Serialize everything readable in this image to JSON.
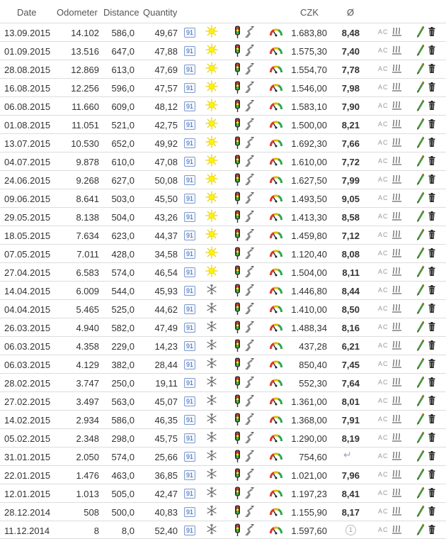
{
  "header": {
    "date": "Date",
    "odometer": "Odometer",
    "distance": "Distance",
    "quantity": "Quantity",
    "price": "CZK",
    "consumption": "Ø"
  },
  "colors": {
    "fuel_badge": "#3466b3",
    "summer_sun": "#f5e600",
    "pencil_body": "#4caa3a",
    "pencil_tip": "#d84a1b",
    "traffic_light": "#333333"
  },
  "rows": [
    {
      "date": "13.09.2015",
      "odometer": "14.102",
      "distance": "586,0",
      "quantity": "49,67",
      "fuel": "91",
      "season": "summer",
      "price": "1.683,80",
      "consumption": "8,48",
      "consumption_icon": ""
    },
    {
      "date": "01.09.2015",
      "odometer": "13.516",
      "distance": "647,0",
      "quantity": "47,88",
      "fuel": "91",
      "season": "summer",
      "price": "1.575,30",
      "consumption": "7,40",
      "consumption_icon": ""
    },
    {
      "date": "28.08.2015",
      "odometer": "12.869",
      "distance": "613,0",
      "quantity": "47,69",
      "fuel": "91",
      "season": "summer",
      "price": "1.554,70",
      "consumption": "7,78",
      "consumption_icon": ""
    },
    {
      "date": "16.08.2015",
      "odometer": "12.256",
      "distance": "596,0",
      "quantity": "47,57",
      "fuel": "91",
      "season": "summer",
      "price": "1.546,00",
      "consumption": "7,98",
      "consumption_icon": ""
    },
    {
      "date": "06.08.2015",
      "odometer": "11.660",
      "distance": "609,0",
      "quantity": "48,12",
      "fuel": "91",
      "season": "summer",
      "price": "1.583,10",
      "consumption": "7,90",
      "consumption_icon": ""
    },
    {
      "date": "01.08.2015",
      "odometer": "11.051",
      "distance": "521,0",
      "quantity": "42,75",
      "fuel": "91",
      "season": "summer",
      "price": "1.500,00",
      "consumption": "8,21",
      "consumption_icon": ""
    },
    {
      "date": "13.07.2015",
      "odometer": "10.530",
      "distance": "652,0",
      "quantity": "49,92",
      "fuel": "91",
      "season": "summer",
      "price": "1.692,30",
      "consumption": "7,66",
      "consumption_icon": ""
    },
    {
      "date": "04.07.2015",
      "odometer": "9.878",
      "distance": "610,0",
      "quantity": "47,08",
      "fuel": "91",
      "season": "summer",
      "price": "1.610,00",
      "consumption": "7,72",
      "consumption_icon": ""
    },
    {
      "date": "24.06.2015",
      "odometer": "9.268",
      "distance": "627,0",
      "quantity": "50,08",
      "fuel": "91",
      "season": "summer",
      "price": "1.627,50",
      "consumption": "7,99",
      "consumption_icon": ""
    },
    {
      "date": "09.06.2015",
      "odometer": "8.641",
      "distance": "503,0",
      "quantity": "45,50",
      "fuel": "91",
      "season": "summer",
      "price": "1.493,50",
      "consumption": "9,05",
      "consumption_icon": ""
    },
    {
      "date": "29.05.2015",
      "odometer": "8.138",
      "distance": "504,0",
      "quantity": "43,26",
      "fuel": "91",
      "season": "summer",
      "price": "1.413,30",
      "consumption": "8,58",
      "consumption_icon": ""
    },
    {
      "date": "18.05.2015",
      "odometer": "7.634",
      "distance": "623,0",
      "quantity": "44,37",
      "fuel": "91",
      "season": "summer",
      "price": "1.459,80",
      "consumption": "7,12",
      "consumption_icon": ""
    },
    {
      "date": "07.05.2015",
      "odometer": "7.011",
      "distance": "428,0",
      "quantity": "34,58",
      "fuel": "91",
      "season": "summer",
      "price": "1.120,40",
      "consumption": "8,08",
      "consumption_icon": ""
    },
    {
      "date": "27.04.2015",
      "odometer": "6.583",
      "distance": "574,0",
      "quantity": "46,54",
      "fuel": "91",
      "season": "summer",
      "price": "1.504,00",
      "consumption": "8,11",
      "consumption_icon": ""
    },
    {
      "date": "14.04.2015",
      "odometer": "6.009",
      "distance": "544,0",
      "quantity": "45,93",
      "fuel": "91",
      "season": "winter",
      "price": "1.446,80",
      "consumption": "8,44",
      "consumption_icon": ""
    },
    {
      "date": "04.04.2015",
      "odometer": "5.465",
      "distance": "525,0",
      "quantity": "44,62",
      "fuel": "91",
      "season": "winter",
      "price": "1.410,00",
      "consumption": "8,50",
      "consumption_icon": ""
    },
    {
      "date": "26.03.2015",
      "odometer": "4.940",
      "distance": "582,0",
      "quantity": "47,49",
      "fuel": "91",
      "season": "winter",
      "price": "1.488,34",
      "consumption": "8,16",
      "consumption_icon": ""
    },
    {
      "date": "06.03.2015",
      "odometer": "4.358",
      "distance": "229,0",
      "quantity": "14,23",
      "fuel": "91",
      "season": "winter",
      "price": "437,28",
      "consumption": "6,21",
      "consumption_icon": ""
    },
    {
      "date": "06.03.2015",
      "odometer": "4.129",
      "distance": "382,0",
      "quantity": "28,44",
      "fuel": "91",
      "season": "winter",
      "price": "850,40",
      "consumption": "7,45",
      "consumption_icon": ""
    },
    {
      "date": "28.02.2015",
      "odometer": "3.747",
      "distance": "250,0",
      "quantity": "19,11",
      "fuel": "91",
      "season": "winter",
      "price": "552,30",
      "consumption": "7,64",
      "consumption_icon": ""
    },
    {
      "date": "27.02.2015",
      "odometer": "3.497",
      "distance": "563,0",
      "quantity": "45,07",
      "fuel": "91",
      "season": "winter",
      "price": "1.361,00",
      "consumption": "8,01",
      "consumption_icon": ""
    },
    {
      "date": "14.02.2015",
      "odometer": "2.934",
      "distance": "586,0",
      "quantity": "46,35",
      "fuel": "91",
      "season": "winter",
      "price": "1.368,00",
      "consumption": "7,91",
      "consumption_icon": ""
    },
    {
      "date": "05.02.2015",
      "odometer": "2.348",
      "distance": "298,0",
      "quantity": "45,75",
      "fuel": "91",
      "season": "winter",
      "price": "1.290,00",
      "consumption": "8,19",
      "consumption_icon": ""
    },
    {
      "date": "31.01.2015",
      "odometer": "2.050",
      "distance": "574,0",
      "quantity": "25,66",
      "fuel": "91",
      "season": "winter",
      "price": "754,60",
      "consumption": "",
      "consumption_icon": "return"
    },
    {
      "date": "22.01.2015",
      "odometer": "1.476",
      "distance": "463,0",
      "quantity": "36,85",
      "fuel": "91",
      "season": "winter",
      "price": "1.021,00",
      "consumption": "7,96",
      "consumption_icon": ""
    },
    {
      "date": "12.01.2015",
      "odometer": "1.013",
      "distance": "505,0",
      "quantity": "42,47",
      "fuel": "91",
      "season": "winter",
      "price": "1.197,23",
      "consumption": "8,41",
      "consumption_icon": ""
    },
    {
      "date": "28.12.2014",
      "odometer": "508",
      "distance": "500,0",
      "quantity": "40,83",
      "fuel": "91",
      "season": "winter",
      "price": "1.155,90",
      "consumption": "8,17",
      "consumption_icon": ""
    },
    {
      "date": "11.12.2014",
      "odometer": "8",
      "distance": "8,0",
      "quantity": "52,40",
      "fuel": "91",
      "season": "winter",
      "price": "1.597,60",
      "consumption": "",
      "consumption_icon": "first",
      "first_mark": "1"
    }
  ],
  "ac_label": "AC"
}
